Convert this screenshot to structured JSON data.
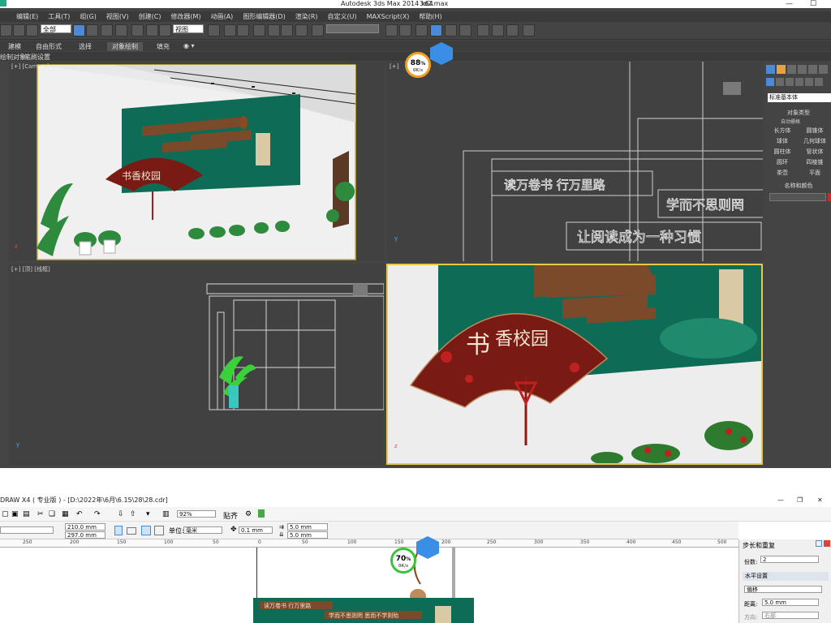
{
  "max": {
    "title": "Autodesk 3ds Max  2014 x64",
    "file": "3d2.max",
    "menu": [
      "编辑(E)",
      "工具(T)",
      "组(G)",
      "视图(V)",
      "创建(C)",
      "修改器(M)",
      "动画(A)",
      "图形编辑器(D)",
      "渲染(R)",
      "自定义(U)",
      "MAXScript(X)",
      "帮助(H)"
    ],
    "select_filter": "全部",
    "ref_coord": "视图",
    "ribbon_tabs": [
      "建模",
      "自由形式",
      "选择",
      "对象绘制",
      "填充"
    ],
    "ribbon_sub": [
      "绘制对象",
      "笔刷设置"
    ],
    "vp_camera": "[+] [Camera]",
    "vp_front": "[+]",
    "vp_top": "[+] [顶] [线框]",
    "badge1": "88",
    "badge_unit": "%",
    "badge1_speed": "0K/s",
    "fan_text": "书香校园",
    "text_line1": "读万卷书  行万里路",
    "text_line2": "学而不思则罔",
    "text_line3": "让阅读成为一种习惯",
    "cmd": {
      "standard": "标准基本体",
      "rollout_type": "对象类型",
      "autogrid": "自动栅格",
      "items": [
        "长方体",
        "圆锥体",
        "球体",
        "几何球体",
        "圆柱体",
        "管状体",
        "圆环",
        "四棱锥",
        "茶壶",
        "平面"
      ],
      "rollout_name": "名称和颜色"
    }
  },
  "corel": {
    "title": "DRAW X4 ( 专业版 ) - [D:\\2022年\\6月\\6.15\\28\\28.cdr]",
    "zoom": "92%",
    "snap": "贴齐",
    "width": "210.0 mm",
    "height": "297.0 mm",
    "unit_label": "单位:",
    "unit": "毫米",
    "nudge": "0.1 mm",
    "dup_x": "5.0 mm",
    "dup_y": "5.0 mm",
    "ruler": [
      "250",
      "200",
      "150",
      "100",
      "50",
      "0",
      "50",
      "100",
      "150",
      "200",
      "250",
      "300",
      "350",
      "400",
      "450",
      "500"
    ],
    "badge2": "70",
    "badge2_speed": "0K/s",
    "canvas_text1": "读万卷书  行万里路",
    "canvas_text2": "学而不思则罔  思而不学则殆",
    "dock": {
      "title": "步长和重复",
      "copies_label": "份数:",
      "copies": "2",
      "section": "水平设置",
      "mode": "偏移",
      "distance_label": "距离:",
      "distance": "5.0 mm",
      "direction_label": "方向:",
      "direction": "右部"
    }
  },
  "colors": {
    "green": "#0e6b55",
    "maroon": "#7a1a14",
    "accent": "#4b8ad8"
  }
}
